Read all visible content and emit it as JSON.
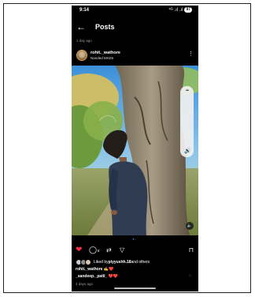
{
  "status_bar": {
    "time": "9:14",
    "signal_text": "⁴ᴳ .ıl .ıl",
    "battery": "97"
  },
  "header": {
    "back_icon": "arrow-left-icon",
    "title": "Posts"
  },
  "previous_post_time": "1 day ago",
  "post": {
    "username": "rohit._wathore",
    "location": "Nanded MH26",
    "more_icon": "vertical-dots-icon",
    "comment_count": "8",
    "liked_by_prefix": "Liked by ",
    "liked_by_user": "piyyushh.18",
    "liked_by_suffix": " and others",
    "caption": "rohit._wathore ✍❤️",
    "comment": "_sandeep._patil_ ❤️❤️",
    "time_ago": "4 days ago",
    "volume_dots": "• • •",
    "volume_icon": "🔊",
    "mute_icon": "🔈"
  },
  "colors": {
    "background": "#000000",
    "like_red": "#ff3040",
    "pager_blue": "#3897f0"
  }
}
